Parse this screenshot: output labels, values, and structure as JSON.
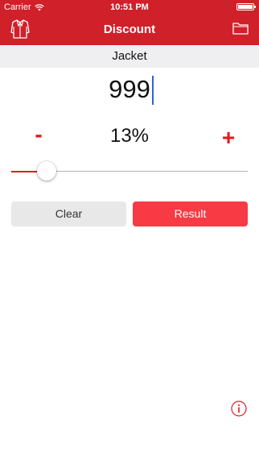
{
  "status_bar": {
    "carrier": "Carrier",
    "time": "10:51 PM"
  },
  "nav": {
    "title": "Discount"
  },
  "item": {
    "name": "Jacket"
  },
  "price": {
    "value": "999"
  },
  "discount": {
    "percent_label": "13%",
    "minus_label": "-",
    "plus_label": "+",
    "slider_fraction": 0.15
  },
  "buttons": {
    "clear_label": "Clear",
    "result_label": "Result"
  },
  "colors": {
    "brand_red": "#d0202a",
    "accent_red": "#e8161e",
    "result_button": "#f73a44",
    "caret_blue": "#2f62d6"
  },
  "icons": {
    "left_nav": "jacket-icon",
    "right_nav": "folder-icon",
    "info": "info-icon"
  }
}
